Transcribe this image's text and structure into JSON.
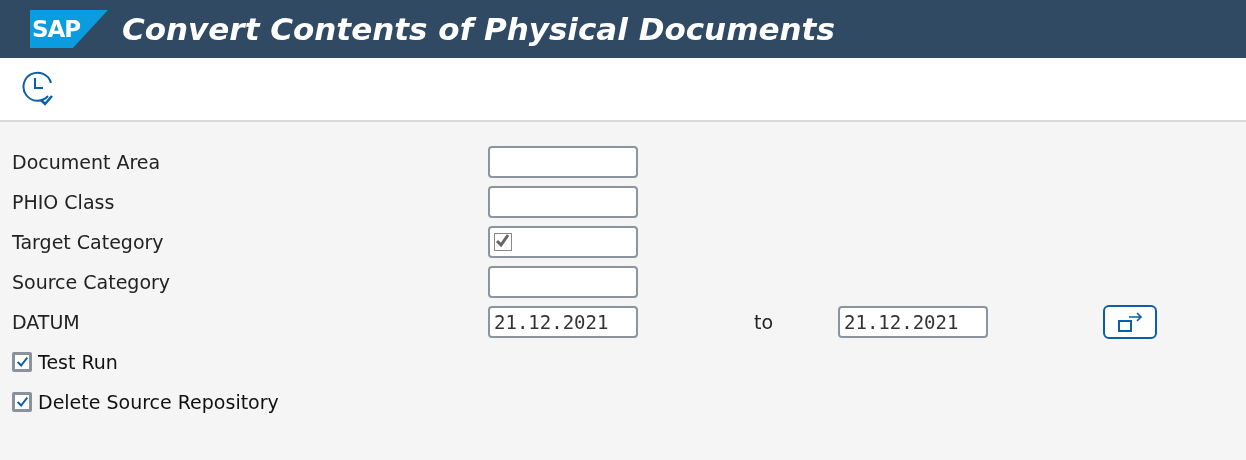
{
  "header": {
    "logo": "SAP",
    "title": "Convert Contents of Physical Documents"
  },
  "fields": [
    {
      "label": "Document Area",
      "kind": "text"
    },
    {
      "label": "PHIO Class",
      "kind": "text"
    },
    {
      "label": "Target Category",
      "kind": "checkbox",
      "checked": true
    },
    {
      "label": "Source Category",
      "kind": "text"
    },
    {
      "label": "DATUM",
      "kind": "range",
      "value": "21.12.2021",
      "to_label": "to",
      "to_value": "21.12.2021"
    }
  ],
  "options": [
    {
      "label": "Test Run",
      "checked": true
    },
    {
      "label": "Delete Source Repository",
      "checked": true
    }
  ]
}
